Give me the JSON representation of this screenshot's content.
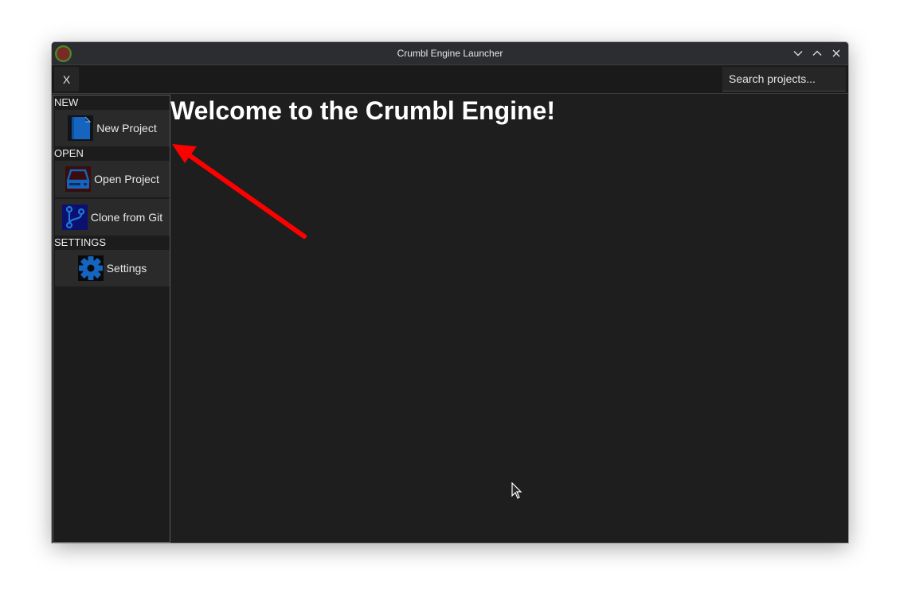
{
  "window": {
    "title": "Crumbl Engine Launcher",
    "controls": [
      "chevron-down-icon",
      "chevron-up-icon",
      "close-icon"
    ]
  },
  "toolbar": {
    "close_label": "X",
    "search_placeholder": "Search projects..."
  },
  "sidebar": {
    "new_section": "NEW",
    "new_project": "New Project",
    "open_section": "OPEN",
    "open_project": "Open Project",
    "clone_git": "Clone from Git",
    "settings_section": "SETTINGS",
    "settings": "Settings"
  },
  "main": {
    "welcome": "Welcome to the Crumbl Engine!"
  },
  "colors": {
    "window_bg": "#1e1e1e",
    "titlebar_bg": "#2b2d30",
    "button_bg": "#2a2a2a",
    "icon_blue": "#1565c0",
    "annotation_arrow": "#ff0000"
  }
}
